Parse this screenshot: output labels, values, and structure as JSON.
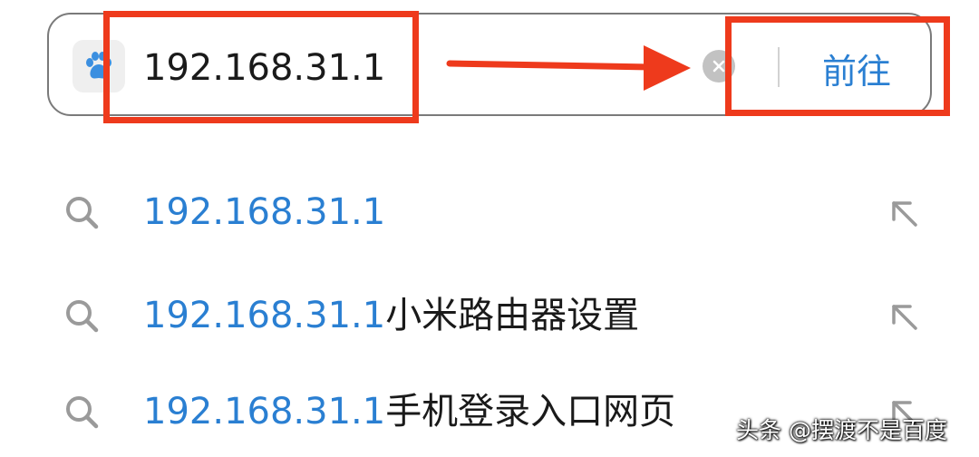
{
  "search": {
    "query": "192.168.31.1",
    "go_label": "前往"
  },
  "suggestions": [
    {
      "highlight": "192.168.31.1",
      "rest": ""
    },
    {
      "highlight": "192.168.31.1",
      "rest": "小米路由器设置"
    },
    {
      "highlight": "192.168.31.1",
      "rest": "手机登录入口网页"
    }
  ],
  "watermark": "头条 @摆渡不是百度",
  "icons": {
    "engine": "paw-icon",
    "clear": "clear-icon",
    "suggestion": "search-icon",
    "fill": "arrow-up-left-icon"
  },
  "colors": {
    "accent": "#2a7fd2",
    "annotation": "#ee3a1c",
    "text": "#1a1a1a",
    "icon_gray": "#9a9a9a"
  }
}
